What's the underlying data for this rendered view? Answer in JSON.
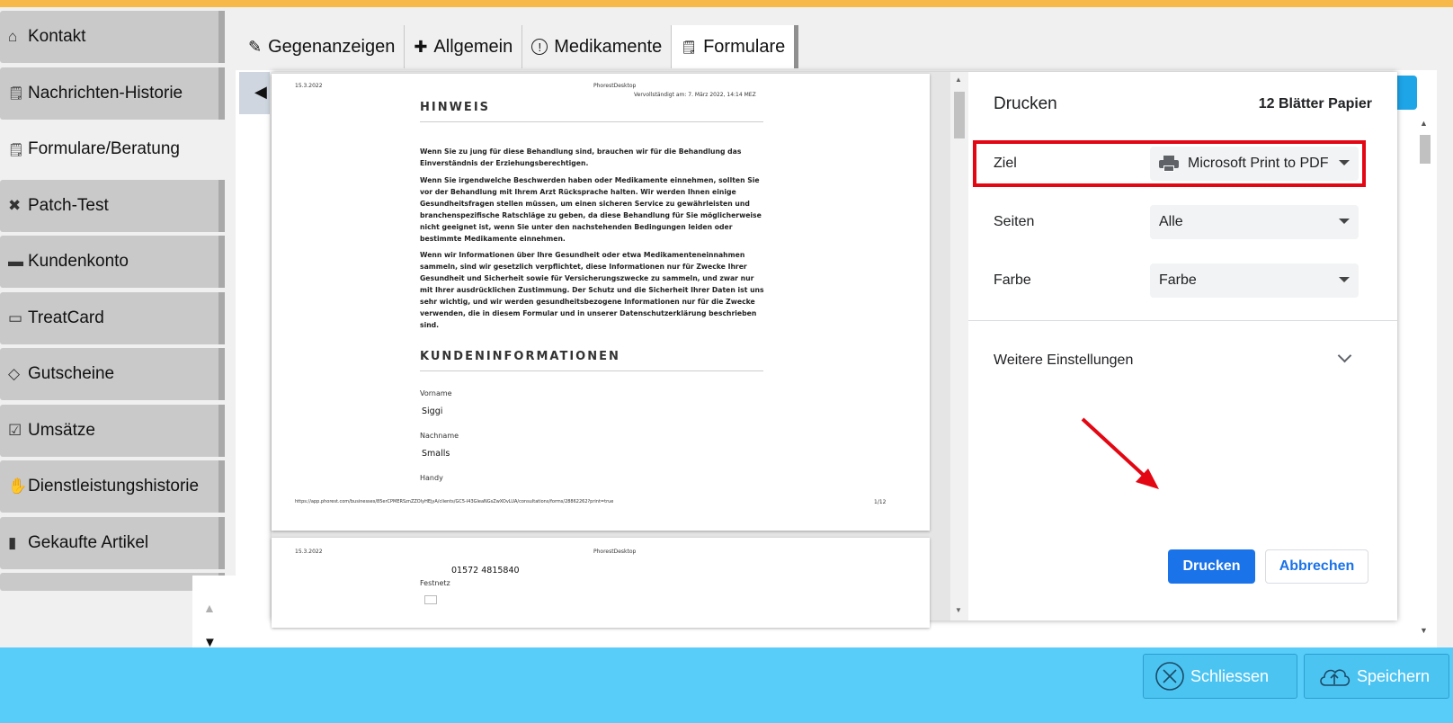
{
  "sidebar": {
    "items": [
      {
        "icon": "home-icon",
        "glyph": "⌂",
        "label": "Kontakt"
      },
      {
        "icon": "clipboard-icon",
        "glyph": "📋",
        "label": "Nachrichten-Historie"
      },
      {
        "icon": "clipboard-icon",
        "glyph": "📋",
        "label": "Formulare/Beratung"
      },
      {
        "icon": "bandage-icon",
        "glyph": "✖",
        "label": "Patch-Test"
      },
      {
        "icon": "card-icon",
        "glyph": "▬",
        "label": "Kundenkonto"
      },
      {
        "icon": "treatcard-icon",
        "glyph": "▭",
        "label": "TreatCard"
      },
      {
        "icon": "tag-icon",
        "glyph": "◇",
        "label": "Gutscheine"
      },
      {
        "icon": "chart-icon",
        "glyph": "☑",
        "label": "Umsätze"
      },
      {
        "icon": "handshake-icon",
        "glyph": "✋",
        "label": "Dienstleistungshistorie"
      },
      {
        "icon": "bottle-icon",
        "glyph": "▮",
        "label": "Gekaufte Artikel"
      }
    ],
    "active_index": 2
  },
  "tabs": [
    {
      "icon": "pencil-icon",
      "glyph": "✎",
      "label": "Gegenanzeigen"
    },
    {
      "icon": "plus-icon",
      "glyph": "✚",
      "label": "Allgemein"
    },
    {
      "icon": "alert-icon",
      "glyph": "ⓘ",
      "label": "Medikamente"
    },
    {
      "icon": "clipboard-icon",
      "glyph": "📋",
      "label": "Formulare"
    }
  ],
  "active_tab": 3,
  "preview": {
    "page1": {
      "date": "15.3.2022",
      "app": "PhorestDesktop",
      "completed": "Vervollständigt am: 7. März 2022, 14:14 MEZ",
      "section1_title": "HINWEIS",
      "para1": "Wenn Sie zu jung für diese Behandlung sind, brauchen wir für die Behandlung das Einverständnis der Erziehungsberechtigen.",
      "para2": "Wenn Sie irgendwelche Beschwerden haben oder Medikamente einnehmen, sollten Sie vor der Behandlung mit Ihrem Arzt Rücksprache halten. Wir werden Ihnen einige Gesundheitsfragen stellen müssen, um einen sicheren Service zu gewährleisten und branchenspezifische Ratschläge zu geben, da diese Behandlung für Sie möglicherweise nicht geeignet ist, wenn Sie unter den nachstehenden Bedingungen leiden oder bestimmte Medikamente einnehmen.",
      "para3": "Wenn wir Informationen über Ihre Gesundheit oder etwa Medikamenteneinnahmen sammeln, sind wir gesetzlich verpflichtet, diese Informationen nur für Zwecke Ihrer Gesundheit und Sicherheit sowie für Versicherungszwecke zu sammeln, und zwar nur mit Ihrer ausdrücklichen Zustimmung. Der Schutz und die Sicherheit Ihrer Daten ist uns sehr wichtig, und wir werden gesundheitsbezogene Informationen nur für die Zwecke verwenden, die in diesem Formular und in unserer Datenschutzerklärung beschrieben sind.",
      "section2_title": "KUNDENINFORMATIONEN",
      "firstname_label": "Vorname",
      "firstname_value": "Siggi",
      "lastname_label": "Nachname",
      "lastname_value": "Smalls",
      "mobile_label": "Handy",
      "footer_url": "https://app.phorest.com/businesses/85erCPMERSznZZOlyHEjyA/clients/GC5-I43GleaNGsZwXOvLUA/consultations/forms/28862262?print=true",
      "page_number": "1/12"
    },
    "page2": {
      "date": "15.3.2022",
      "app": "PhorestDesktop",
      "phone": "01572 4815840",
      "landline_label": "Festnetz"
    }
  },
  "print": {
    "title": "Drucken",
    "sheets": "12 Blätter Papier",
    "destination_label": "Ziel",
    "destination_value": "Microsoft Print to PDF",
    "pages_label": "Seiten",
    "pages_value": "Alle",
    "color_label": "Farbe",
    "color_value": "Farbe",
    "more_settings": "Weitere Einstellungen",
    "print_button": "Drucken",
    "cancel_button": "Abbrechen",
    "highlight_color": "#e30613",
    "accent_color": "#1a73e8"
  },
  "footer": {
    "close_label": "Schliessen",
    "save_label": "Speichern"
  },
  "colors": {
    "topbar": "#f6b94a",
    "bottombar": "#59cdf9"
  }
}
